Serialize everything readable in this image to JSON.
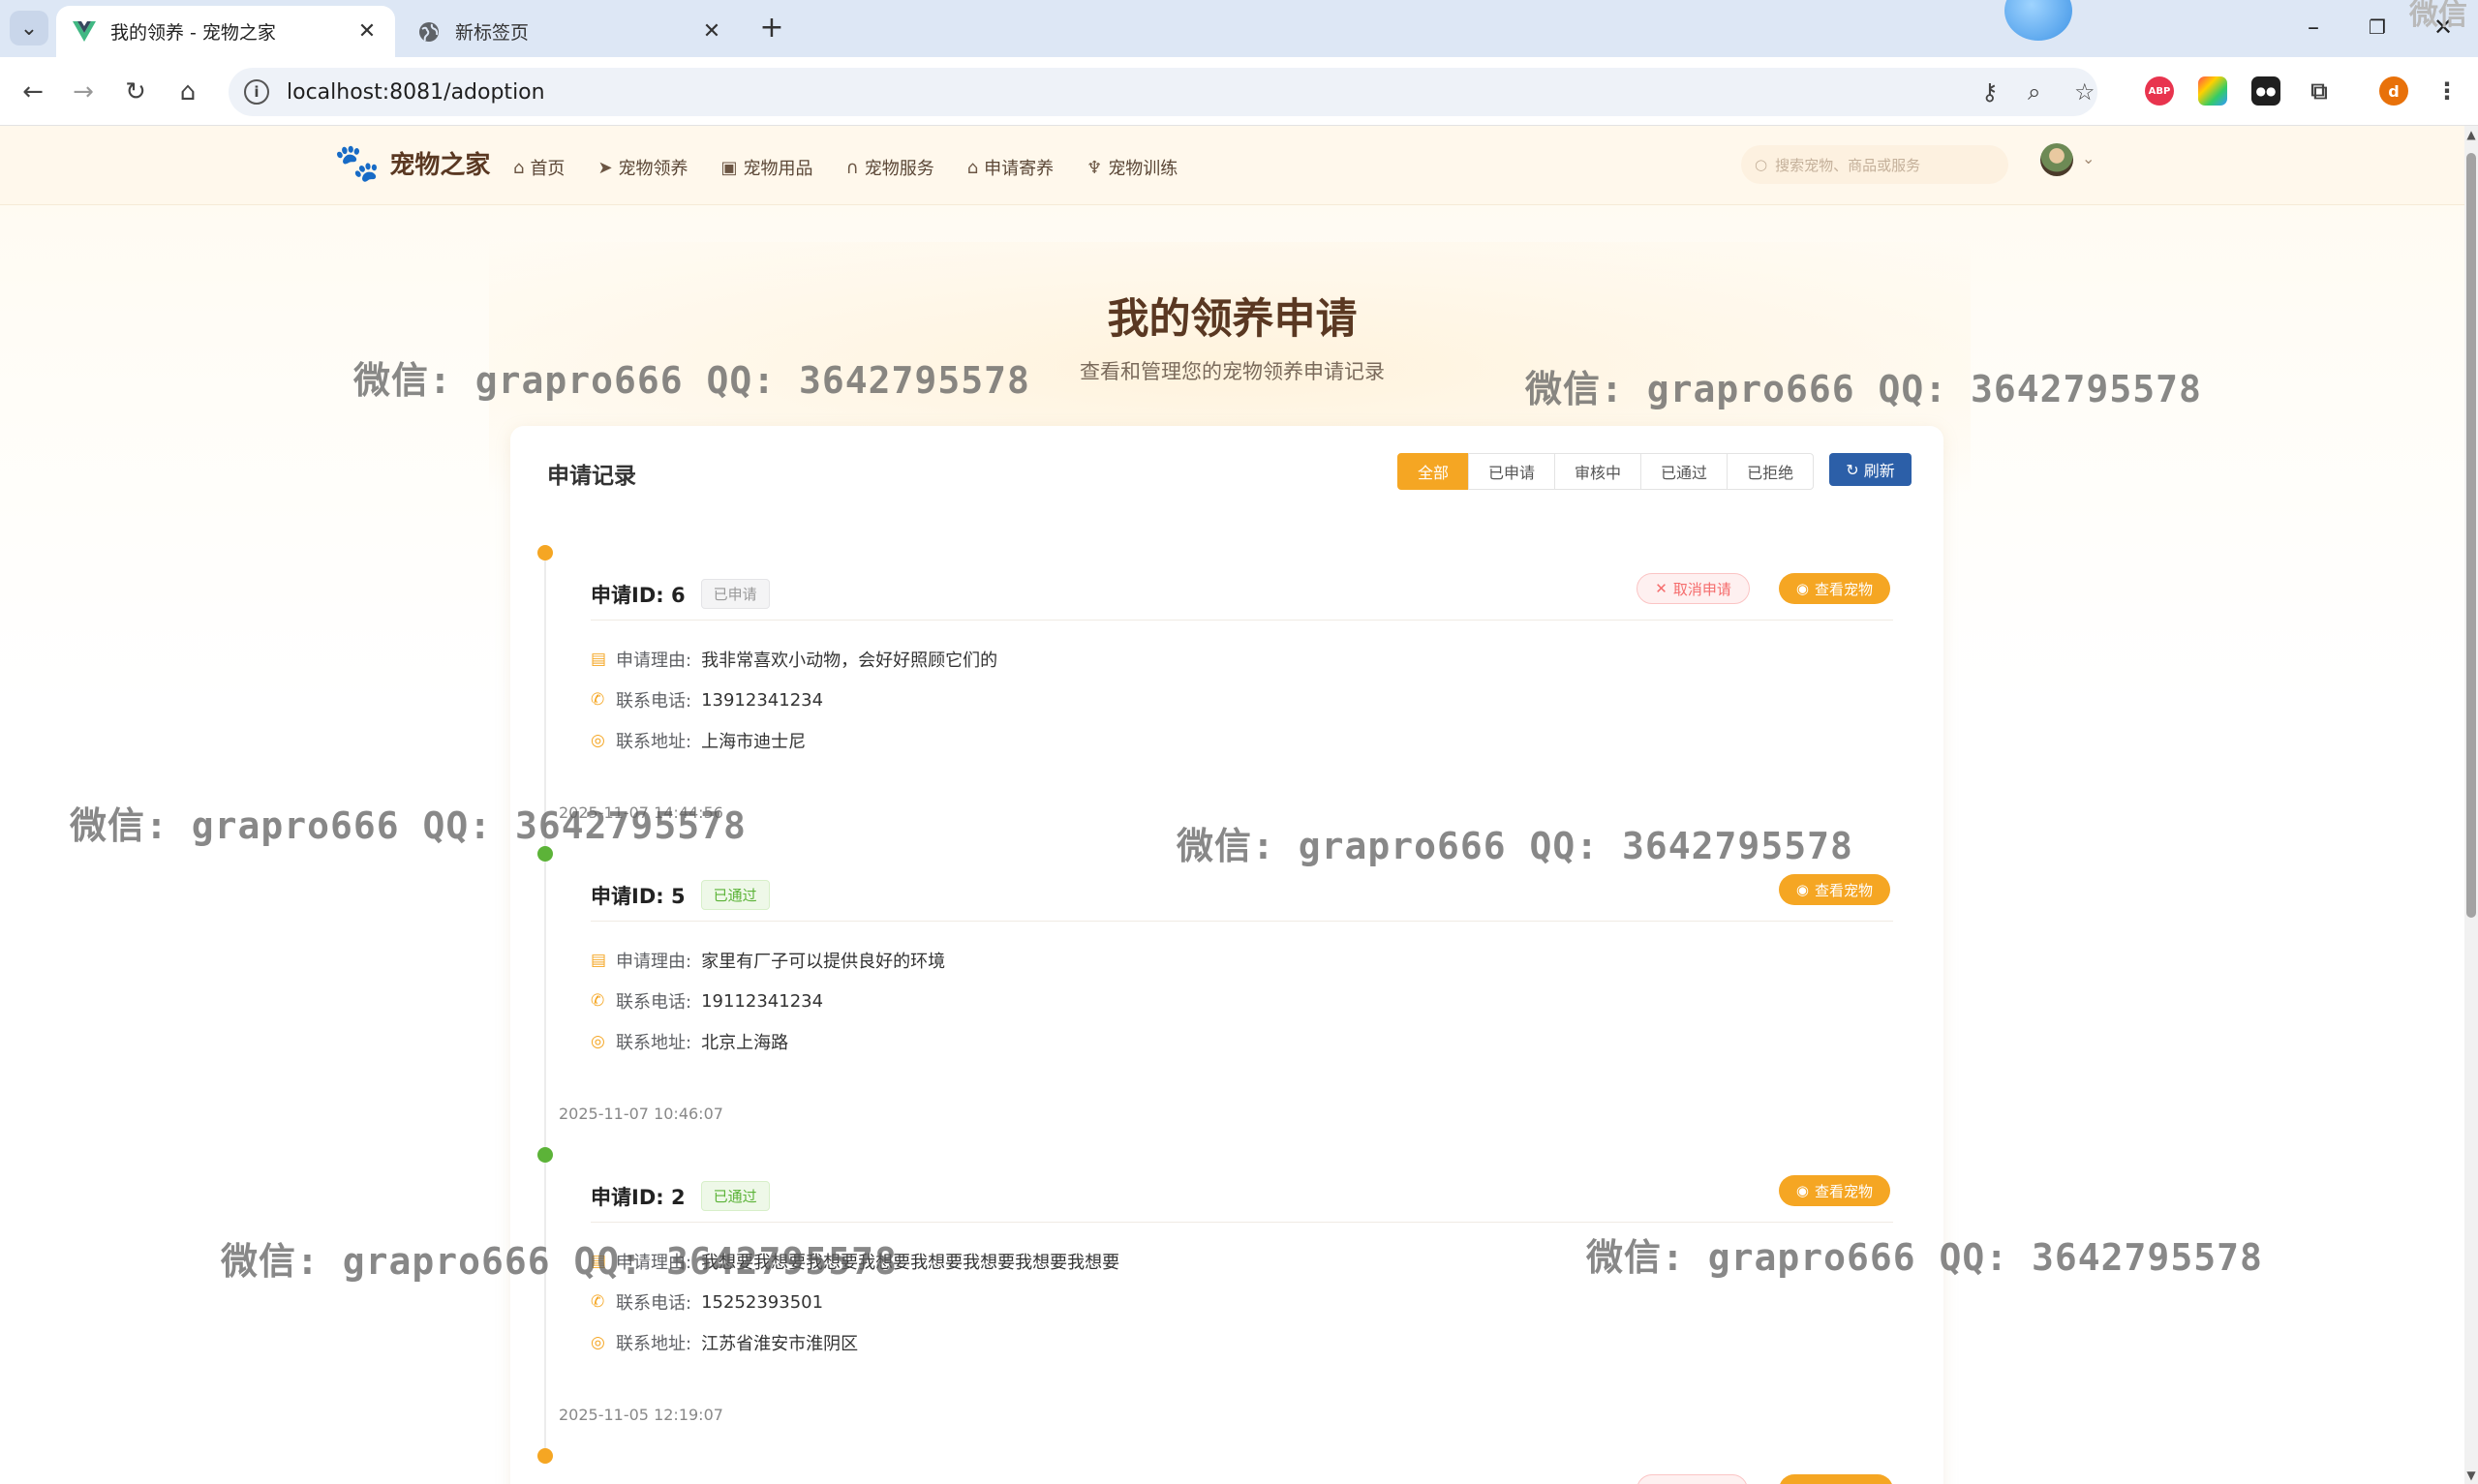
{
  "browser": {
    "tabs": [
      {
        "title": "我的领养 - 宠物之家",
        "active": true,
        "favicon": "vue-logo-icon"
      },
      {
        "title": "新标签页",
        "active": false,
        "favicon": "globe-icon"
      }
    ],
    "url": "localhost:8081/adoption",
    "corner_text": "微信",
    "profile_initial": "d"
  },
  "site": {
    "brand": "宠物之家",
    "nav": [
      "首页",
      "宠物领养",
      "宠物用品",
      "宠物服务",
      "申请寄养",
      "宠物训练"
    ],
    "search_placeholder": "搜索宠物、商品或服务"
  },
  "hero": {
    "title": "我的领养申请",
    "subtitle": "查看和管理您的宠物领养申请记录"
  },
  "panel": {
    "title": "申请记录",
    "filters": [
      "全部",
      "已申请",
      "审核中",
      "已通过",
      "已拒绝"
    ],
    "active_filter": "全部",
    "refresh_label": "刷新"
  },
  "labels": {
    "reason": "申请理由:",
    "phone": "联系电话:",
    "address": "联系地址:",
    "cancel": "取消申请",
    "view": "查看宠物"
  },
  "records": [
    {
      "id_label": "申请ID: 6",
      "status": "已申请",
      "reason": "我非常喜欢小动物，会好好照顾它们的",
      "phone": "13912341234",
      "address": "上海市迪士尼",
      "time": "2025-11-07 14:44:56",
      "can_cancel": true
    },
    {
      "id_label": "申请ID: 5",
      "status": "已通过",
      "reason": "家里有厂子可以提供良好的环境",
      "phone": "19112341234",
      "address": "北京上海路",
      "time": "2025-11-07 10:46:07",
      "can_cancel": false
    },
    {
      "id_label": "申请ID: 2",
      "status": "已通过",
      "reason": "我想要我想要我想要我想要我想要我想要我想要我想要",
      "phone": "15252393501",
      "address": "江苏省淮安市淮阴区",
      "time": "2025-11-05 12:19:07",
      "can_cancel": false
    }
  ],
  "watermark_text": "微信: grapro666 QQ: 3642795578",
  "colors": {
    "accent": "#f5a623",
    "refresh": "#2c5fa8",
    "passed": "#5cb338",
    "brand_text": "#5a3822"
  }
}
